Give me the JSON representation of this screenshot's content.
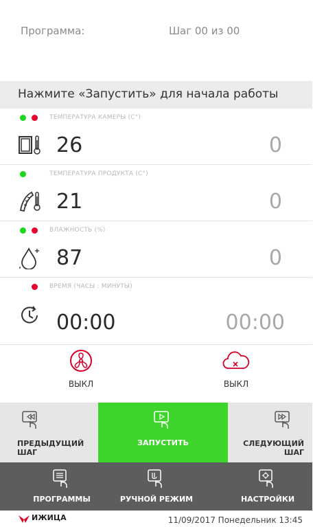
{
  "header": {
    "program_label": "Программа:",
    "step_label": "Шаг 00 из 00"
  },
  "hint": "Нажмите «Запустить» для начала работы",
  "params": [
    {
      "title": "ТЕМПЕРАТУРА КАМЕРЫ (C°)",
      "value": "26",
      "target": "0",
      "indicators": [
        "green",
        "red"
      ],
      "icon": "chamber-thermometer-icon"
    },
    {
      "title": "ТЕМПЕРАТУРА ПРОДУКТА (C°)",
      "value": "21",
      "target": "0",
      "indicators": [
        "green"
      ],
      "icon": "product-probe-thermometer-icon"
    },
    {
      "title": "ВЛАЖНОСТЬ (%)",
      "value": "87",
      "target": "0",
      "indicators": [
        "green",
        "red"
      ],
      "icon": "humidity-drop-icon"
    },
    {
      "title": "ВРЕМЯ (ЧАСЫ : МИНУТЫ)",
      "value": "00:00",
      "target": "00:00",
      "indicators": [
        "red"
      ],
      "icon": "clock-icon"
    }
  ],
  "toggles": {
    "fan": {
      "label": "ВЫКЛ",
      "icon": "fan-icon"
    },
    "smoke": {
      "label": "ВЫКЛ",
      "icon": "cloud-off-icon"
    }
  },
  "step_controls": {
    "prev": "ПРЕДЫДУЩИЙ ШАГ",
    "start": "ЗАПУСТИТЬ",
    "next": "СЛЕДУЮЩИЙ ШАГ"
  },
  "nav": {
    "programs": "ПРОГРАММЫ",
    "manual": "РУЧНОЙ РЕЖИМ",
    "settings": "НАСТРОЙКИ"
  },
  "footer": {
    "brand": "ИЖИЦА",
    "datetime": "11/09/2017  Понедельник 13:45"
  },
  "colors": {
    "accent_green": "#3fd42b",
    "indicator_green": "#1bd61b",
    "indicator_red": "#e8002d",
    "nav_bar": "#5d5d5d",
    "brand_red": "#d6002a"
  }
}
